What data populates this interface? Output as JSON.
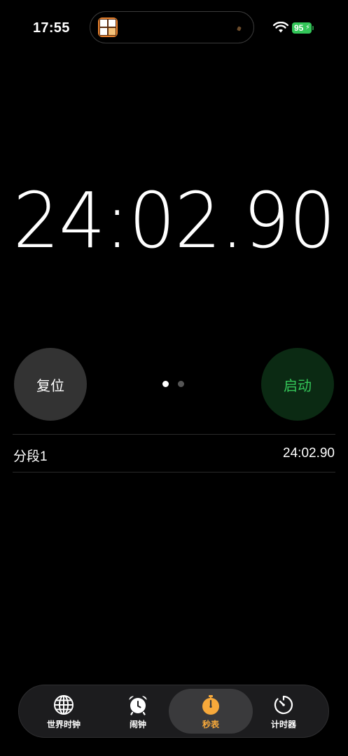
{
  "status_bar": {
    "time": "17:55",
    "battery": "95",
    "icons": [
      "app-activity-icon",
      "wifi-icon",
      "battery-icon"
    ]
  },
  "stopwatch": {
    "display": "24:02.90"
  },
  "controls": {
    "reset_label": "复位",
    "start_label": "启动",
    "start_color": "#34c759",
    "page_count": 2,
    "active_page": 1
  },
  "laps": [
    {
      "label": "分段1",
      "time": "24:02.90"
    }
  ],
  "tab_bar": {
    "accent": "#f7a93b",
    "items": [
      {
        "label": "世界时钟",
        "icon": "globe-icon"
      },
      {
        "label": "闹钟",
        "icon": "alarm-clock-icon"
      },
      {
        "label": "秒表",
        "icon": "stopwatch-icon",
        "selected": true
      },
      {
        "label": "计时器",
        "icon": "timer-icon"
      }
    ]
  }
}
